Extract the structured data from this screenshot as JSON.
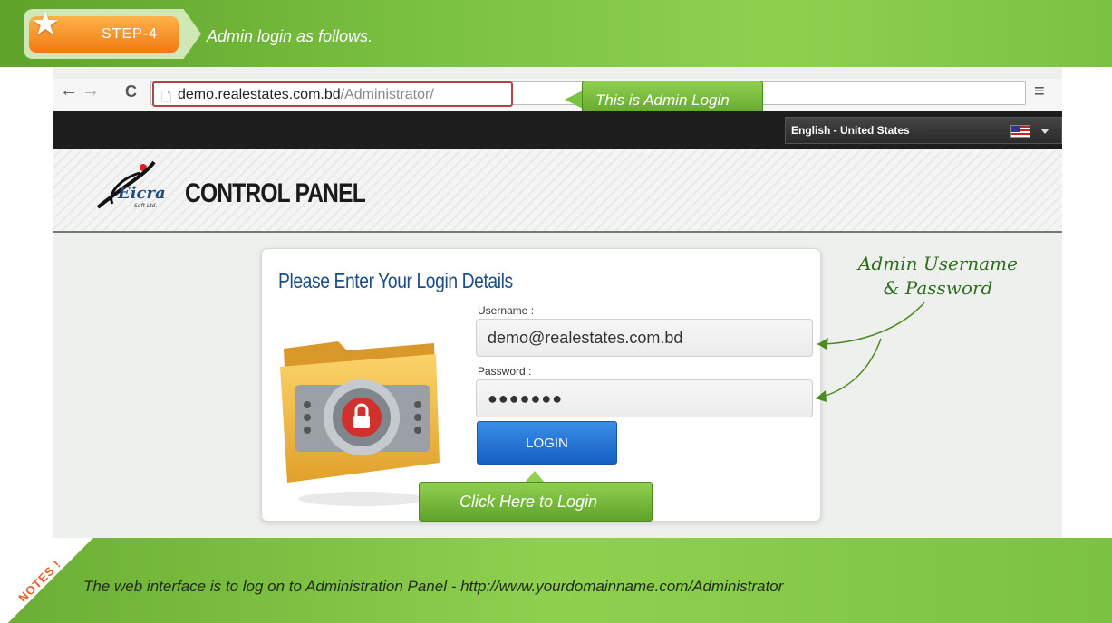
{
  "banner": {
    "step_label": "STEP-4",
    "title": "Admin login as follows."
  },
  "browser": {
    "url_domain": "demo.realestates.com.bd",
    "url_path": "/Administrator/",
    "url_callout": "This is Admin Login Path",
    "language": "English - United States"
  },
  "panel": {
    "logo_text": "Eicra Soft Ltd.",
    "title": "CONTROL PANEL"
  },
  "login": {
    "heading": "Please Enter Your Login Details",
    "username_label": "Username :",
    "username_value": "demo@realestates.com.bd",
    "password_label": "Password :",
    "password_value": "●●●●●●●",
    "button_label": "LOGIN",
    "callout": "Click Here to Login"
  },
  "annotation": {
    "line1": "Admin Username",
    "line2": "& Password"
  },
  "notes": {
    "tag": "NOTES !",
    "text": "The web interface is to log on to Administration Panel - http://www.yourdomainname.com/Administrator"
  },
  "colors": {
    "banner_green": "#7cc242",
    "heading_blue": "#1d4d84",
    "button_blue": "#1660c4",
    "step_orange": "#f07a12"
  }
}
